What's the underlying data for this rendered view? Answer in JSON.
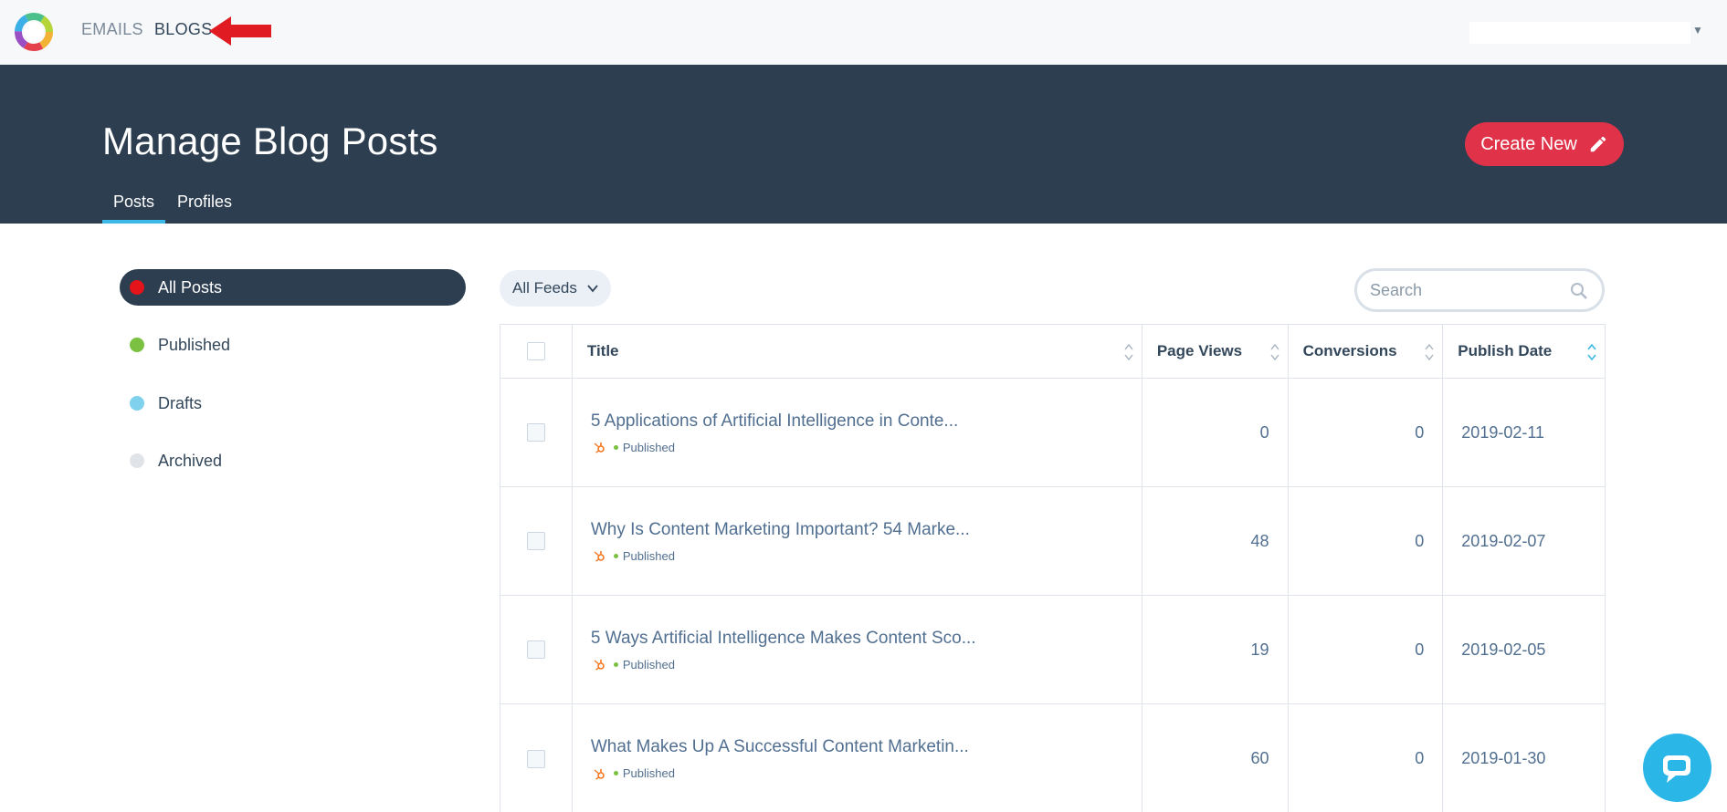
{
  "nav": {
    "links": [
      "EMAILS",
      "BLOGS"
    ]
  },
  "header": {
    "title": "Manage Blog Posts",
    "create_label": "Create New",
    "tabs": [
      "Posts",
      "Profiles"
    ]
  },
  "sidebar": {
    "filters": [
      {
        "label": "All Posts",
        "color": "#e5141b",
        "active": true
      },
      {
        "label": "Published",
        "color": "#7ac142",
        "active": false
      },
      {
        "label": "Drafts",
        "color": "#7fd1ee",
        "active": false
      },
      {
        "label": "Archived",
        "color": "#e0e3e7",
        "active": false
      }
    ]
  },
  "toolbar": {
    "feeds_label": "All Feeds",
    "search_placeholder": "Search"
  },
  "table": {
    "columns": [
      "Title",
      "Page Views",
      "Conversions",
      "Publish Date"
    ],
    "rows": [
      {
        "title": "5 Applications of Artificial Intelligence in Conte...",
        "status": "Published",
        "views": "0",
        "conversions": "0",
        "date": "2019-02-11"
      },
      {
        "title": "Why Is Content Marketing Important? 54 Marke...",
        "status": "Published",
        "views": "48",
        "conversions": "0",
        "date": "2019-02-07"
      },
      {
        "title": "5 Ways Artificial Intelligence Makes Content Sco...",
        "status": "Published",
        "views": "19",
        "conversions": "0",
        "date": "2019-02-05"
      },
      {
        "title": "What Makes Up A Successful Content Marketin...",
        "status": "Published",
        "views": "60",
        "conversions": "0",
        "date": "2019-01-30"
      }
    ]
  },
  "icons": {
    "logo": "ring-logo-icon",
    "arrow": "red-arrow-icon",
    "create": "pencil-icon",
    "feeds": "chevron-down-icon",
    "search": "search-icon",
    "sort": "sort-icon",
    "status": "hubspot-sprocket-icon",
    "chat": "chat-icon"
  },
  "colors": {
    "header_bg": "#2d3e50",
    "accent_tab": "#3db9e8",
    "create_button": "#e0334a",
    "chat_bubble": "#2bb6e8"
  }
}
